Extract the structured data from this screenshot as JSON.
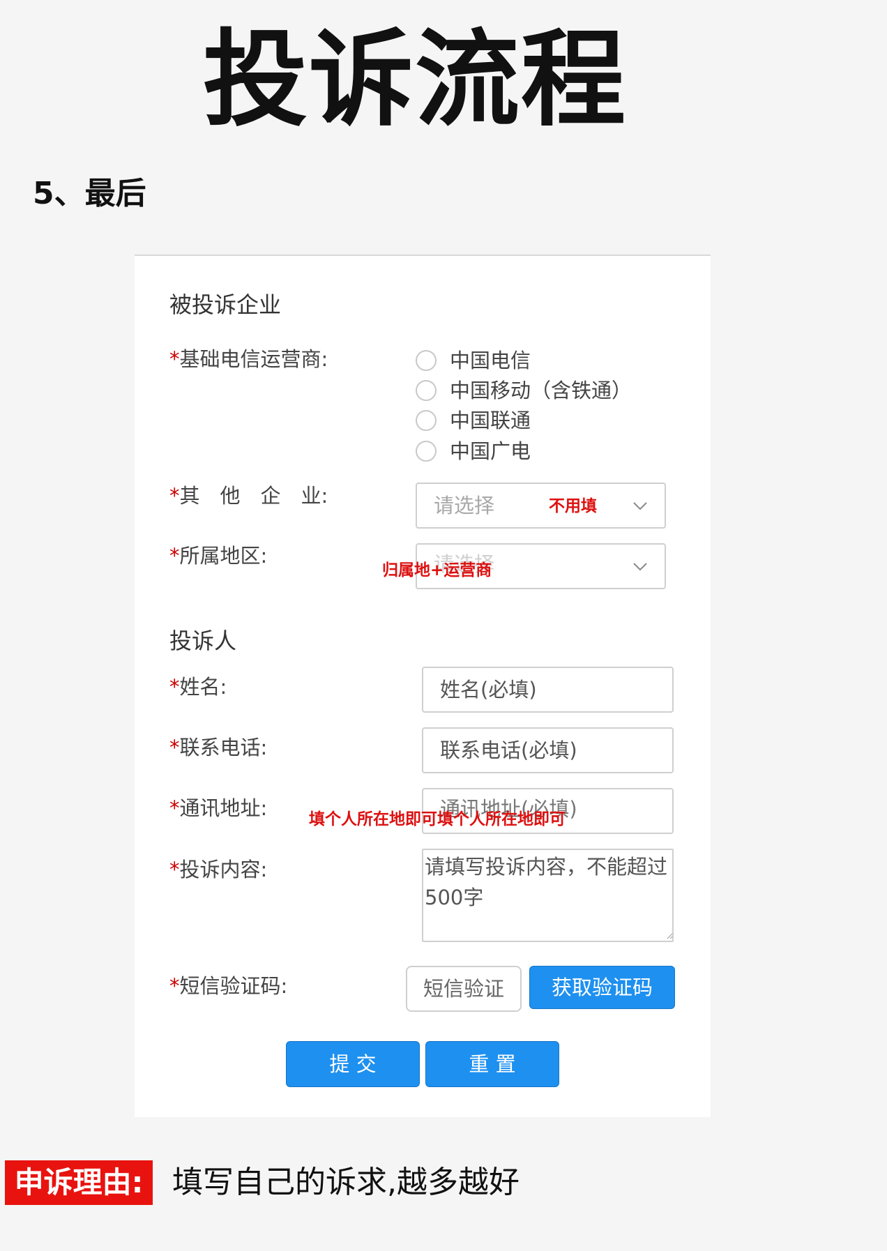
{
  "header": {
    "title": "投诉流程",
    "step": "5、最后"
  },
  "form": {
    "section_company": "被投诉企业",
    "required_mark": "*",
    "operator_label": "基础电信运营商:",
    "operators": [
      "中国电信",
      "中国移动（含铁通）",
      "中国联通",
      "中国广电"
    ],
    "other_company_label": "其　他　企　业:",
    "other_company_placeholder": "请选择",
    "other_company_note": "不用填",
    "region_label": "所属地区:",
    "region_placeholder": "请选择",
    "region_note": "归属地+运营商",
    "section_complainant": "投诉人",
    "name_label": "姓名:",
    "name_placeholder": "姓名(必填)",
    "phone_label": "联系电话:",
    "phone_placeholder": "联系电话(必填)",
    "address_label": "通讯地址:",
    "address_placeholder": "通讯地址(必填)",
    "address_note": "填个人所在地即可填个人所在地即可",
    "content_label": "投诉内容:",
    "content_placeholder": "请填写投诉内容，不能超过500字",
    "sms_label": "短信验证码:",
    "sms_placeholder": "短信验证",
    "sms_button": "获取验证码",
    "submit_button": "提 交",
    "reset_button": "重 置"
  },
  "footer": {
    "badge": "申诉理由:",
    "text": "填写自己的诉求,越多越好"
  },
  "colors": {
    "accent_blue": "#1e90f0",
    "note_red": "#d11111",
    "badge_red": "#e8130f"
  }
}
